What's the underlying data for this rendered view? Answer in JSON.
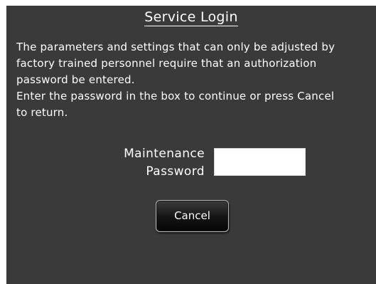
{
  "dialog": {
    "title": "Service Login",
    "message_lines": [
      "The parameters and settings that can only be adjusted by",
      "factory trained personnel require that an authorization",
      "password be entered.",
      "Enter the password in the box to continue or press Cancel",
      "to return."
    ],
    "password_label_line1": "Maintenance",
    "password_label_line2": "Password",
    "password_value": "",
    "cancel_label": "Cancel"
  },
  "colors": {
    "dialog_background": "#3a3a3a",
    "text": "#ffffff",
    "input_background": "#ffffff"
  }
}
